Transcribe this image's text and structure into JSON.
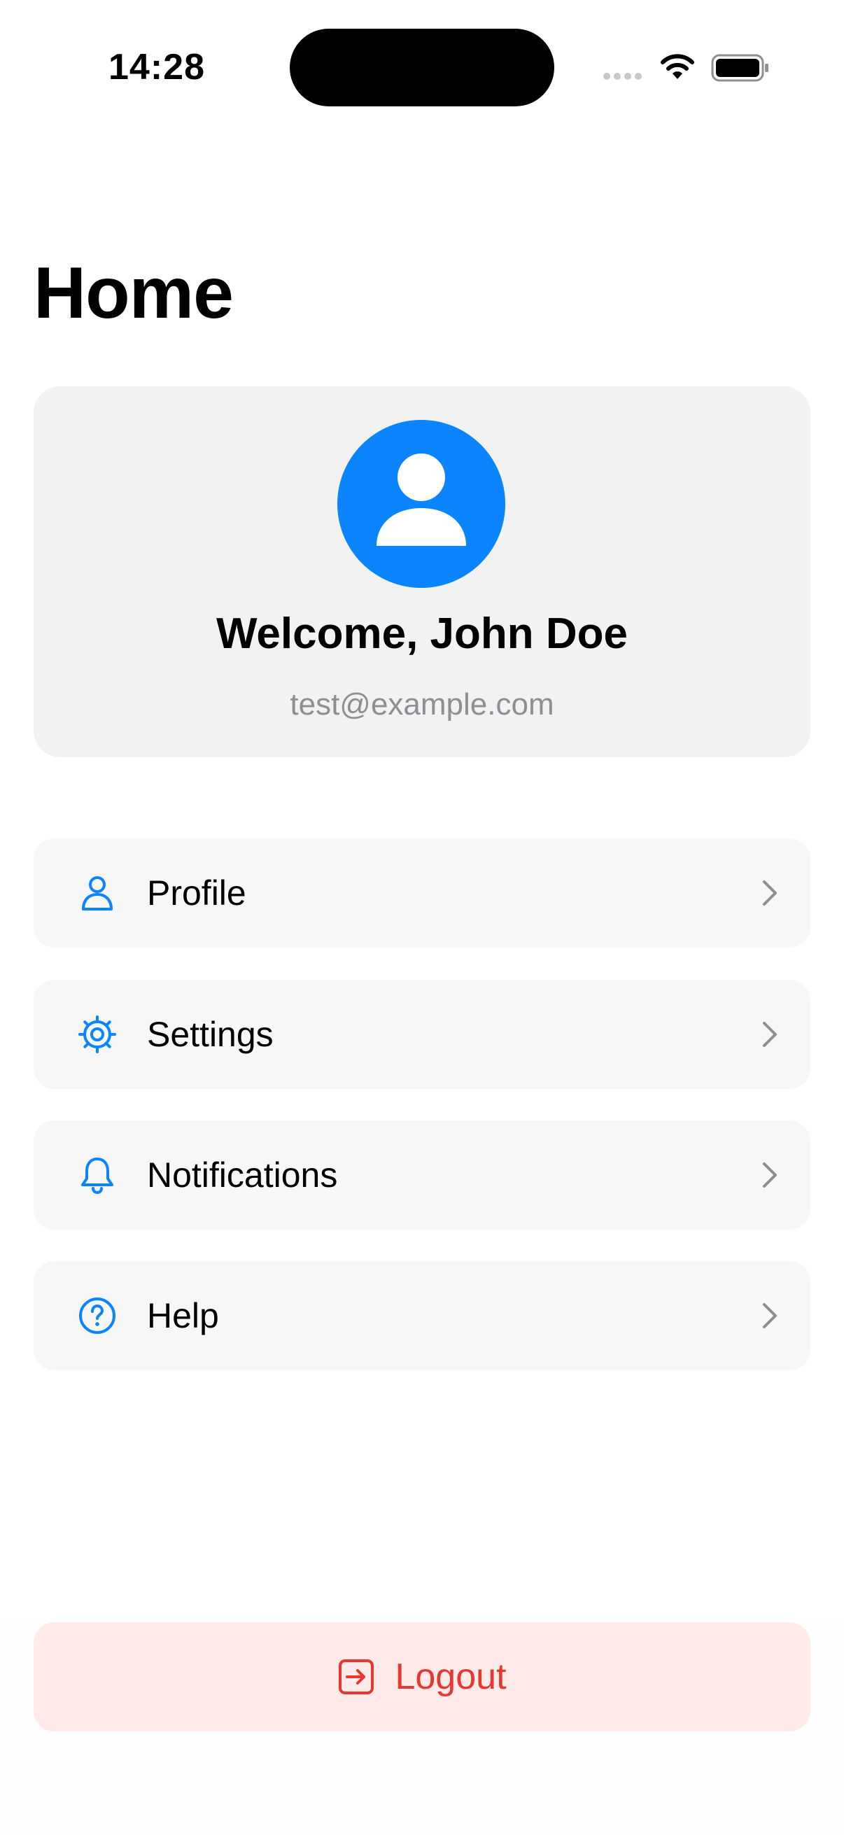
{
  "status_bar": {
    "time": "14:28"
  },
  "page": {
    "title": "Home"
  },
  "welcome": {
    "greeting": "Welcome, John Doe",
    "email": "test@example.com",
    "avatar_icon": "person-circle-icon"
  },
  "menu": {
    "items": [
      {
        "label": "Profile",
        "icon": "person-icon"
      },
      {
        "label": "Settings",
        "icon": "gear-icon"
      },
      {
        "label": "Notifications",
        "icon": "bell-icon"
      },
      {
        "label": "Help",
        "icon": "question-circle-icon"
      }
    ]
  },
  "logout": {
    "label": "Logout",
    "icon": "logout-icon"
  },
  "colors": {
    "accent": "#0a84ff",
    "danger": "#e9362f",
    "danger_bg": "#ffeaea",
    "card_bg": "#f2f2f2",
    "item_bg": "#f7f7f7",
    "secondary_text": "#8e8e93"
  }
}
